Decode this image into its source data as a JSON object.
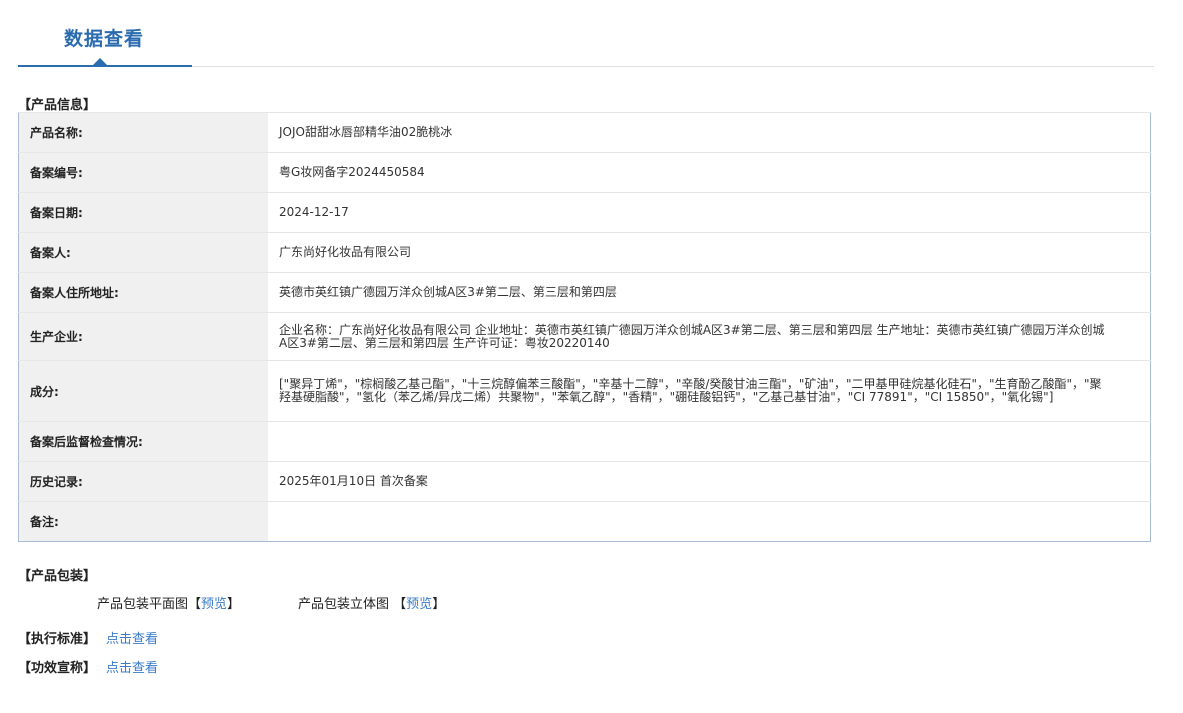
{
  "header": {
    "title": "数据查看"
  },
  "product_info": {
    "section_title": "【产品信息】",
    "rows": [
      {
        "label": "产品名称:",
        "value": "JOJO甜甜冰唇部精华油02脆桃冰"
      },
      {
        "label": "备案编号:",
        "value": "粤G妆网备字2024450584"
      },
      {
        "label": "备案日期:",
        "value": "2024-12-17"
      },
      {
        "label": "备案人:",
        "value": "广东尚好化妆品有限公司"
      },
      {
        "label": "备案人住所地址:",
        "value": "英德市英红镇广德园万洋众创城A区3#第二层、第三层和第四层"
      },
      {
        "label": "生产企业:",
        "value": "企业名称：广东尚好化妆品有限公司 企业地址：英德市英红镇广德园万洋众创城A区3#第二层、第三层和第四层 生产地址：英德市英红镇广德园万洋众创城A区3#第二层、第三层和第四层 生产许可证：粤妆20220140"
      },
      {
        "label": "成分:",
        "value": "[\"聚异丁烯\"，\"棕榈酸乙基己酯\"，\"十三烷醇偏苯三酸酯\"，\"辛基十二醇\"，\"辛酸/癸酸甘油三酯\"，\"矿油\"，\"二甲基甲硅烷基化硅石\"，\"生育酚乙酸酯\"，\"聚羟基硬脂酸\"，\"氢化（苯乙烯/异戊二烯）共聚物\"，\"苯氧乙醇\"，\"香精\"，\"硼硅酸铝钙\"，\"乙基己基甘油\"，\"CI 77891\"，\"CI 15850\"，\"氧化锡\"]"
      },
      {
        "label": "备案后监督检查情况:",
        "value": ""
      },
      {
        "label": "历史记录:",
        "value": "2025年01月10日 首次备案"
      },
      {
        "label": "备注:",
        "value": ""
      }
    ]
  },
  "packaging": {
    "section_title": "【产品包装】",
    "flat_label": "产品包装平面图",
    "solid_label": "产品包装立体图",
    "bracket_open": "【",
    "bracket_close": "】",
    "preview_label": "预览"
  },
  "standard": {
    "section_title": "【执行标准】",
    "link": "点击查看"
  },
  "efficacy": {
    "section_title": "【功效宣称】",
    "link": "点击查看"
  }
}
